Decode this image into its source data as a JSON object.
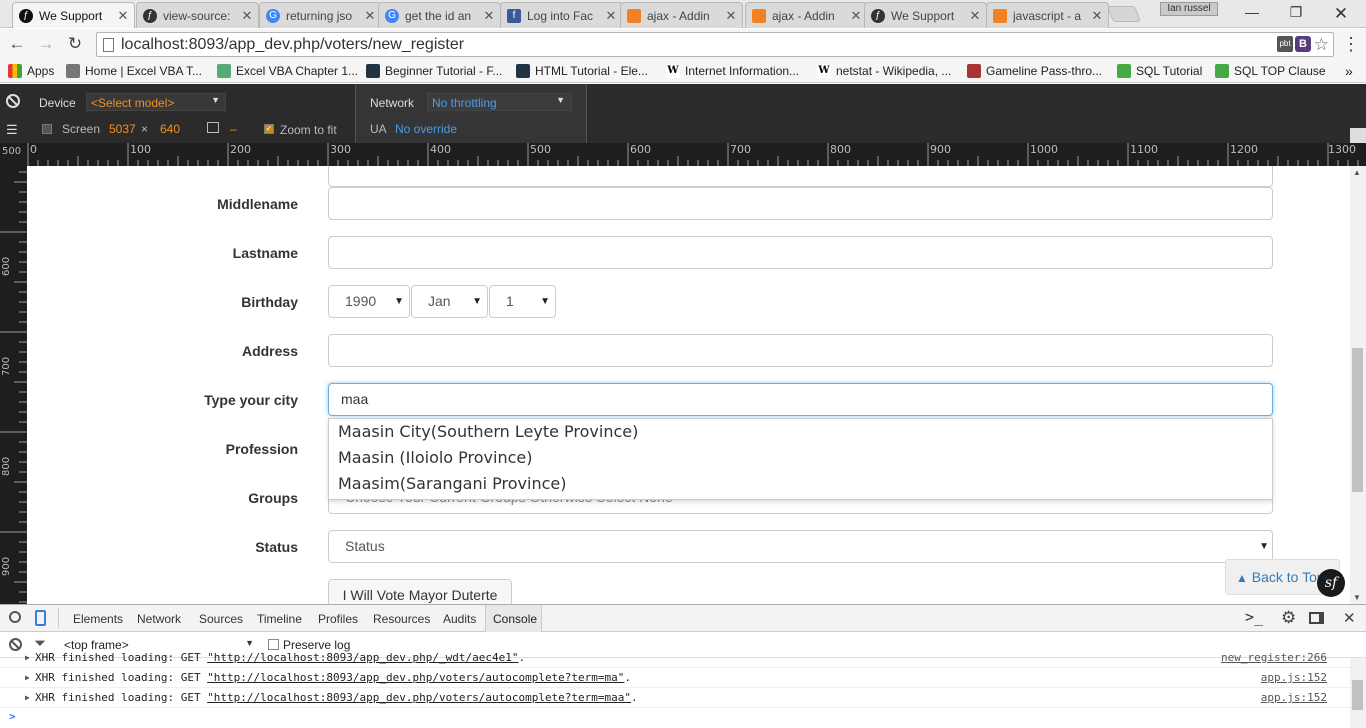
{
  "browser": {
    "tabs": [
      {
        "title": "We Support",
        "icon": "symfony-icon",
        "active": true
      },
      {
        "title": "view-source:",
        "icon": "symfony-icon"
      },
      {
        "title": "returning jso",
        "icon": "google-icon"
      },
      {
        "title": "get the id an",
        "icon": "google-icon"
      },
      {
        "title": "Log into Fac",
        "icon": "facebook-icon"
      },
      {
        "title": "ajax - Addin",
        "icon": "stackoverflow-icon"
      },
      {
        "title": "ajax - Addin",
        "icon": "stackoverflow-icon"
      },
      {
        "title": "We Support",
        "icon": "symfony-icon"
      },
      {
        "title": "javascript - a",
        "icon": "stackoverflow-icon"
      }
    ],
    "user": "Ian russel",
    "url": "localhost:8093/app_dev.php/voters/new_register",
    "bookmarks": [
      {
        "label": "Apps"
      },
      {
        "label": "Home | Excel VBA T..."
      },
      {
        "label": "Excel VBA Chapter 1..."
      },
      {
        "label": "Beginner Tutorial - F..."
      },
      {
        "label": "HTML Tutorial - Ele..."
      },
      {
        "label": "Internet Information..."
      },
      {
        "label": "netstat - Wikipedia, ..."
      },
      {
        "label": "Gameline Pass-thro..."
      },
      {
        "label": "SQL Tutorial"
      },
      {
        "label": "SQL TOP Clause"
      }
    ]
  },
  "device_toolbar": {
    "device_label": "Device",
    "device_value": "<Select model>",
    "screen_label": "Screen",
    "screen_width": "5037",
    "times": "×",
    "screen_height": "640",
    "dash": "–",
    "zoom_label": "Zoom to fit",
    "network_label": "Network",
    "network_value": "No throttling",
    "ua_label": "UA",
    "ua_value": "No override"
  },
  "ruler": {
    "h_ticks": [
      "0",
      "100",
      "200",
      "300",
      "400",
      "500",
      "600",
      "700",
      "800",
      "900",
      "1000",
      "1100",
      "1200",
      "1300"
    ],
    "v_ticks": [
      "500",
      "600",
      "700",
      "800",
      "900"
    ]
  },
  "form": {
    "middlename_label": "Middlename",
    "lastname_label": "Lastname",
    "birthday_label": "Birthday",
    "birth_year": "1990",
    "birth_month": "Jan",
    "birth_day": "1",
    "address_label": "Address",
    "city_label": "Type your city",
    "city_value": "maa",
    "profession_label": "Profession",
    "groups_label": "Groups",
    "groups_placeholder": "Choose Your Current Groups Otherwise Select None",
    "status_label": "Status",
    "status_value": "Status",
    "vote_button": "I Will Vote Mayor Duterte",
    "autocomplete": [
      "Maasin City(Southern Leyte Province)",
      "Maasin (Iloiolo Province)",
      "Maasim(Sarangani Province)"
    ],
    "back_to_top": "Back to Top"
  },
  "devtools": {
    "tabs": [
      "Elements",
      "Network",
      "Sources",
      "Timeline",
      "Profiles",
      "Resources",
      "Audits",
      "Console"
    ],
    "active_tab": "Console",
    "frame": "<top frame>",
    "preserve_log": "Preserve log",
    "logs": [
      {
        "msg": "XHR finished loading: GET ",
        "url": "\"http://localhost:8093/app_dev.php/_wdt/aec4e1\"",
        "tail": ".",
        "src": "new_register:266"
      },
      {
        "msg": "XHR finished loading: GET ",
        "url": "\"http://localhost:8093/app_dev.php/voters/autocomplete?term=ma\"",
        "tail": ".",
        "src": "app.js:152"
      },
      {
        "msg": "XHR finished loading: GET ",
        "url": "\"http://localhost:8093/app_dev.php/voters/autocomplete?term=maa\"",
        "tail": ".",
        "src": "app.js:152"
      }
    ],
    "prompt": ">"
  }
}
